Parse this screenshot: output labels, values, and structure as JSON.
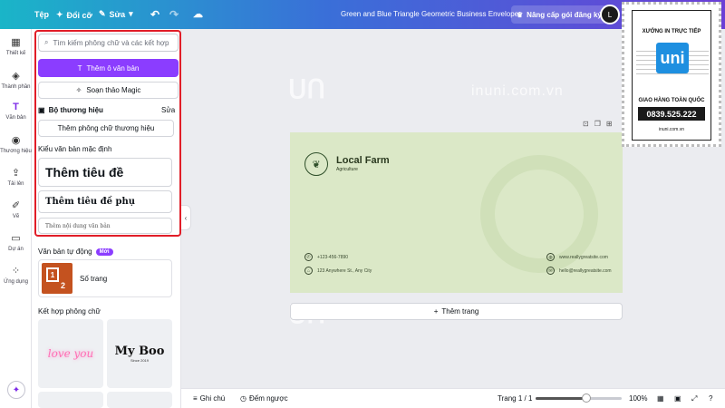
{
  "topbar": {
    "file": "Tệp",
    "change": "Đổi cỡ",
    "edit": "Sửa",
    "title": "Green and Blue Triangle Geometric Business Envelope",
    "upgrade": "Nâng cấp gói đăng ký",
    "avatar": "L"
  },
  "rail": {
    "items": [
      {
        "label": "Thiết kế",
        "icon": "layout-icon"
      },
      {
        "label": "Thành phần",
        "icon": "elements-icon"
      },
      {
        "label": "Văn bản",
        "icon": "text-icon"
      },
      {
        "label": "Thương hiệu",
        "icon": "brand-icon"
      },
      {
        "label": "Tải lên",
        "icon": "upload-icon"
      },
      {
        "label": "Vẽ",
        "icon": "draw-icon"
      },
      {
        "label": "Dự án",
        "icon": "folder-icon"
      },
      {
        "label": "Ứng dụng",
        "icon": "apps-icon"
      }
    ]
  },
  "panel": {
    "search_placeholder": "Tìm kiếm phông chữ và các kết hợp",
    "add_text_box": "Thêm ô văn bản",
    "magic_write": "Soạn thảo Magic",
    "brand_kit": "Bộ thương hiệu",
    "brand_edit": "Sửa",
    "add_brand_fonts": "Thêm phông chữ thương hiệu",
    "default_styles": "Kiểu văn bản mặc định",
    "heading": "Thêm tiêu đề",
    "subheading": "Thêm tiêu đề phụ",
    "body": "Thêm nội dung văn bản",
    "auto_text": "Văn bản tự động",
    "new_badge": "Mới",
    "page_numbers": "Số trang",
    "font_combos": "Kết hợp phông chữ",
    "combo_a": "love you",
    "combo_b": "My Boo",
    "combo_b_sub": "Since 2019"
  },
  "envelope": {
    "brand": "Local Farm",
    "sub": "Agriculture",
    "phone": "+123-456-7890",
    "address": "123 Anywhere St., Any City",
    "website": "www.reallygreatsite.com",
    "email": "hello@reallygreatsite.com"
  },
  "canvas": {
    "add_page": "Thêm trang",
    "watermark": "inuni.com.vn"
  },
  "bottombar": {
    "notes": "Ghi chú",
    "timer": "Đếm ngược",
    "page": "Trang 1 / 1",
    "zoom": "100%",
    "zoom_level": 0.55
  },
  "stamp": {
    "top": "XƯỞNG IN TRỰC TIẾP",
    "logo": "uni",
    "mid": "GIAO HÀNG TOÀN QUỐC",
    "phone": "0839.525.222",
    "site": "inuni.com.vn"
  },
  "colors": {
    "accent": "#8b3dff",
    "highlight": "#e11d28",
    "envelope_bg": "#dbe8c7"
  }
}
